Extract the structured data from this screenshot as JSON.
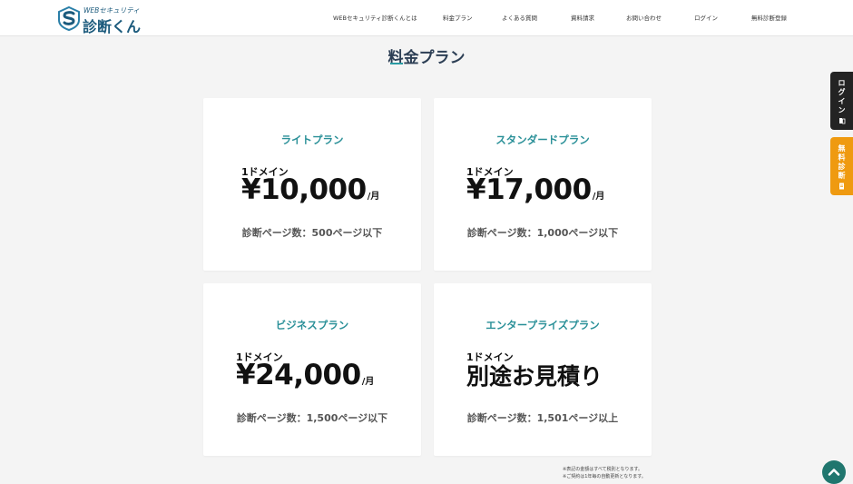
{
  "header": {
    "logo_sub": "WEBセキュリティ",
    "logo_main": "診断くん",
    "nav": [
      {
        "label": "WEBセキュリティ診断くんとは"
      },
      {
        "label": "料金プラン"
      },
      {
        "label": "よくある質問"
      },
      {
        "label": "資料請求"
      },
      {
        "label": "お問い合わせ"
      },
      {
        "label": "ログイン"
      },
      {
        "label": "無料診断登録"
      }
    ]
  },
  "section": {
    "title": "料金プラン"
  },
  "plans": [
    {
      "name": "ライトプラン",
      "domain": "1ドメイン",
      "price": "¥10,000",
      "unit": "/月",
      "pages": "診断ページ数：500ページ以下"
    },
    {
      "name": "スタンダードプラン",
      "domain": "1ドメイン",
      "price": "¥17,000",
      "unit": "/月",
      "pages": "診断ページ数：1,000ページ以下"
    },
    {
      "name": "ビジネスプラン",
      "domain": "1ドメイン",
      "price": "¥24,000",
      "unit": "/月",
      "pages": "診断ページ数：1,500ページ以下"
    },
    {
      "name": "エンタープライズプラン",
      "domain": "1ドメイン",
      "price": "別途お見積り",
      "unit": "",
      "pages": "診断ページ数：1,501ページ以上"
    }
  ],
  "notes": [
    "※表記の金額はすべて税別となります。",
    "※ご契約は1年毎の自動更新となります。"
  ],
  "side": {
    "login_chars": [
      "ロ",
      "グ",
      "イ",
      "ン"
    ],
    "diag_chars": [
      "無",
      "料",
      "診",
      "断"
    ]
  },
  "colors": {
    "accent": "#2a9098",
    "brand": "#1b5a7c",
    "orange": "#ef9a10",
    "dark": "#232323",
    "scroll": "#20766e"
  },
  "icons": {
    "login": "login-icon",
    "diagnosis": "document-icon",
    "scroll_top": "chevron-up-icon"
  }
}
